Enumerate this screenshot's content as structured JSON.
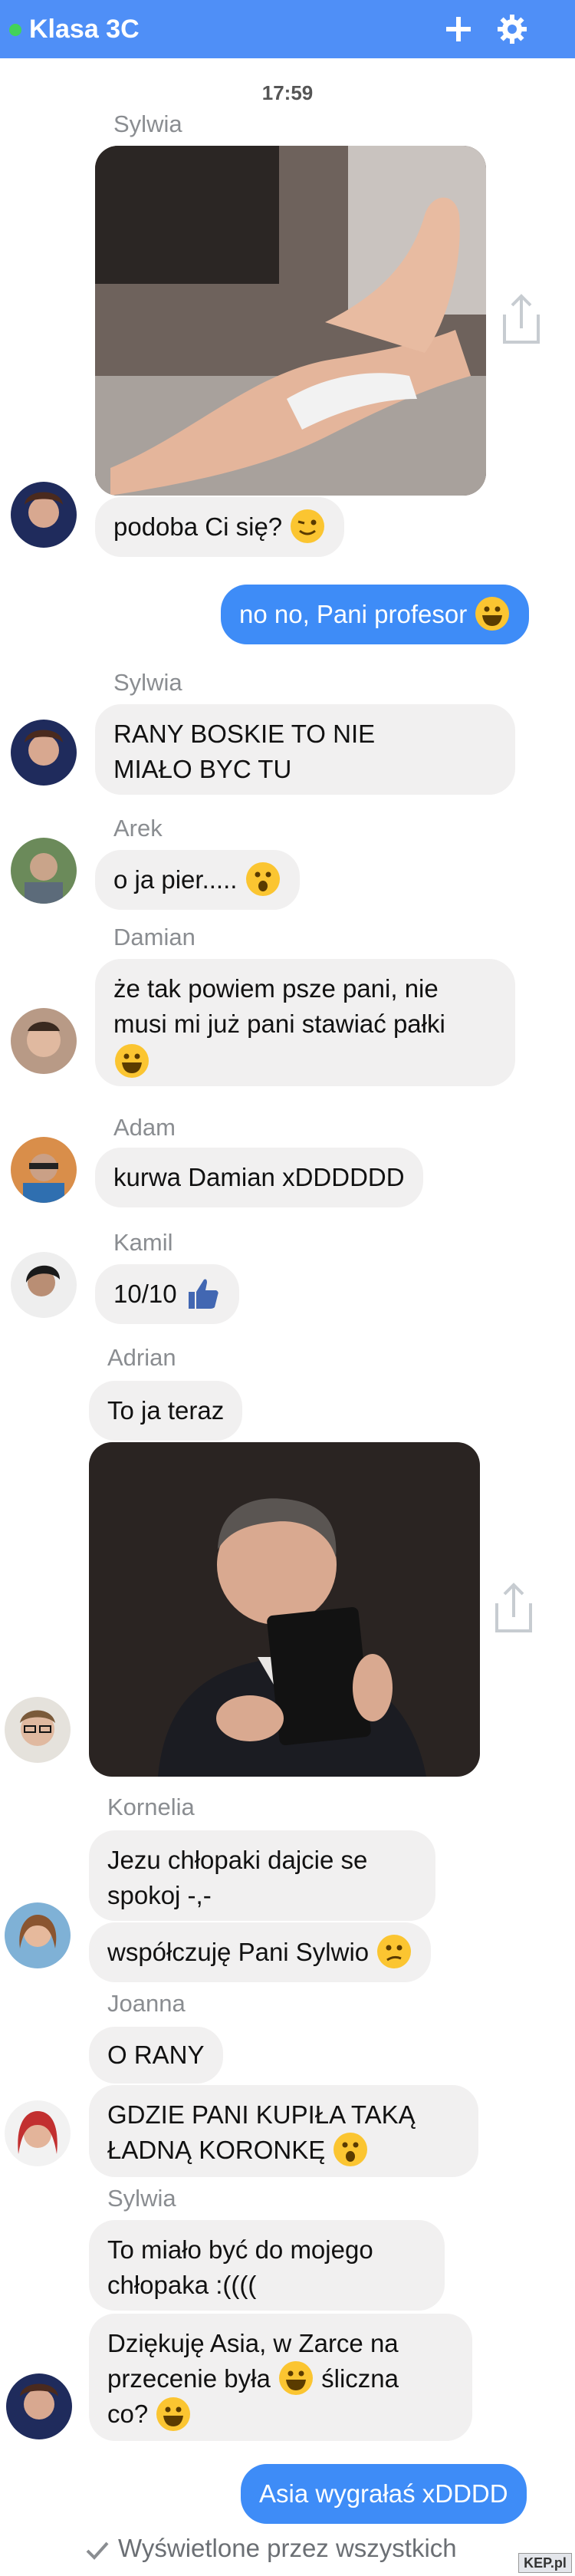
{
  "header": {
    "title": "Klasa 3C",
    "colors": {
      "background": "#4f8ff7",
      "online_dot": "#42d35a"
    },
    "icons": [
      "plus-icon",
      "gear-icon"
    ]
  },
  "chat": {
    "time": "17:59",
    "messages": {
      "m1": {
        "sender": "Sylwia",
        "text": "podoba Ci się?"
      },
      "m2": {
        "text": "no no, Pani profesor"
      },
      "m3": {
        "sender": "Sylwia",
        "line1": "RANY BOSKIE TO NIE",
        "line2": "MIAŁO BYC TU"
      },
      "m4": {
        "sender": "Arek",
        "text": "o ja pier....."
      },
      "m5": {
        "sender": "Damian",
        "line1": "że tak powiem psze pani, nie",
        "line2": "musi mi już pani stawiać pałki"
      },
      "m6": {
        "sender": "Adam",
        "text": "kurwa Damian xDDDDDD"
      },
      "m7": {
        "sender": "Kamil",
        "text": "10/10"
      },
      "m8": {
        "sender": "Adrian",
        "text": "To ja teraz"
      },
      "m9": {
        "sender": "Kornelia",
        "line1": "Jezu chłopaki dajcie se",
        "line2": "spokoj -,-"
      },
      "m10": {
        "text": "współczuję Pani Sylwio"
      },
      "m11": {
        "sender": "Joanna",
        "text": "O RANY"
      },
      "m12": {
        "line1": "GDZIE PANI KUPIŁA TAKĄ",
        "line2": "ŁADNĄ KORONKĘ"
      },
      "m13": {
        "sender": "Sylwia",
        "line1": "To miało być do mojego",
        "line2": "chłopaka :(((("
      },
      "m14": {
        "line1": "Dziękuję Asia, w Zarce na",
        "line2a": "przecenie była",
        "line2b": "śliczna",
        "line3": "co?"
      },
      "m15": {
        "text": "Asia wygrałaś xDDDD"
      }
    },
    "seen": "Wyświetlone przez wszystkich",
    "watermark": "KEP.pl",
    "colors": {
      "my_bubble": "#3e8cf7",
      "their_bubble": "#f1f0f0"
    }
  }
}
